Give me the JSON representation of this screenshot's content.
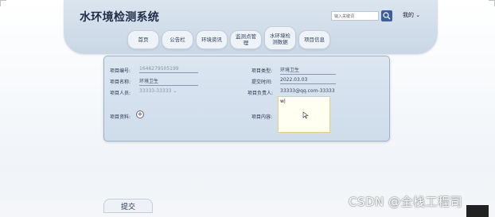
{
  "header": {
    "title": "水环境检测系统",
    "search_placeholder": "输入关键词",
    "mine_label": "我的 ⌄"
  },
  "nav": {
    "tabs": [
      "首页",
      "公告栏",
      "环境资讯",
      "监测点管理",
      "水环境检测数据",
      "项目信息"
    ]
  },
  "form": {
    "project_no_label": "项目编号:",
    "project_no_value": "1646279505199",
    "project_type_label": "项目类型:",
    "project_type_value": "环境卫生",
    "project_name_label": "项目名称:",
    "project_name_value": "环境卫生",
    "submit_time_label": "提交时间:",
    "submit_time_value": "2022.03.03",
    "project_person_label": "项目人员:",
    "project_person_value": "33333-33333 ⌄",
    "owner_label": "项目负责人:",
    "owner_value": "33333@qq.com-33333 ⌄",
    "material_label": "项目资料:",
    "content_label": "项目内容:",
    "content_value": "w|"
  },
  "actions": {
    "submit_label": "提交"
  },
  "watermark": {
    "text": "CSDN @全栈工程司"
  },
  "colors": {
    "accent": "#3b5e9e",
    "panel": "#d5e1ee",
    "textarea_border": "#e6d27a"
  }
}
